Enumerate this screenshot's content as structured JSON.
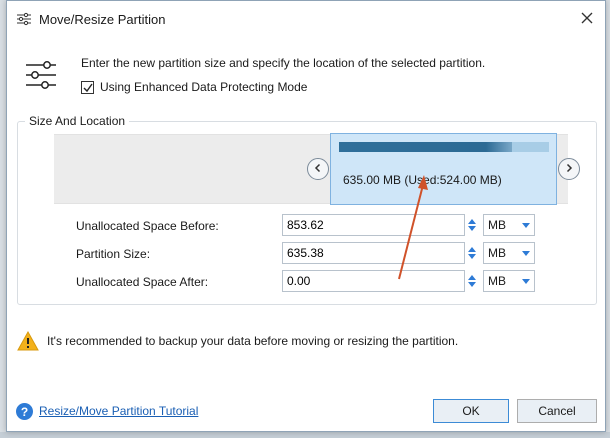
{
  "window": {
    "title": "Move/Resize Partition"
  },
  "header": {
    "description": "Enter the new partition size and specify the location of the selected partition.",
    "enhanced_mode_label": "Using Enhanced Data Protecting Mode",
    "enhanced_mode_checked": true
  },
  "size_location": {
    "group_title": "Size And Location",
    "partition_label": "635.00 MB (Used:524.00 MB)",
    "used_fraction": 0.825
  },
  "fields": [
    {
      "label": "Unallocated Space Before:",
      "value": "853.62",
      "unit": "MB"
    },
    {
      "label": "Partition Size:",
      "value": "635.38",
      "unit": "MB"
    },
    {
      "label": "Unallocated Space After:",
      "value": "0.00",
      "unit": "MB"
    }
  ],
  "warning": {
    "text": "It's recommended to backup your data before moving or resizing the partition."
  },
  "footer": {
    "tutorial_link": "Resize/Move Partition Tutorial",
    "ok_label": "OK",
    "cancel_label": "Cancel"
  },
  "colors": {
    "partition_bg": "#cfe6f8",
    "used_bar": "#2f6f9a",
    "annotation_arrow": "#d0522a"
  }
}
